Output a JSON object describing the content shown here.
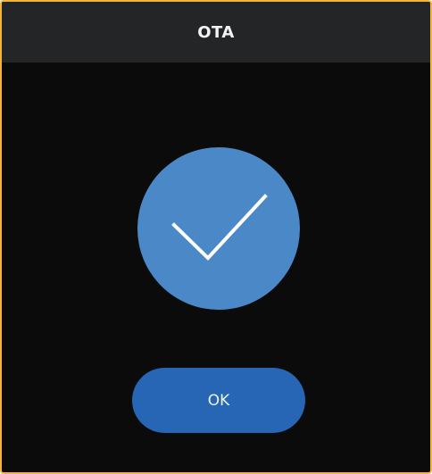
{
  "dialog": {
    "title": "OTA",
    "status_icon": "checkmark-icon",
    "ok_label": "OK"
  },
  "colors": {
    "frame_border": "#f2b53c",
    "background": "#0b0b0b",
    "title_bar": "#242527",
    "success_circle": "#4a88c7",
    "checkmark": "#ffffff",
    "ok_button": "#2666b5"
  }
}
